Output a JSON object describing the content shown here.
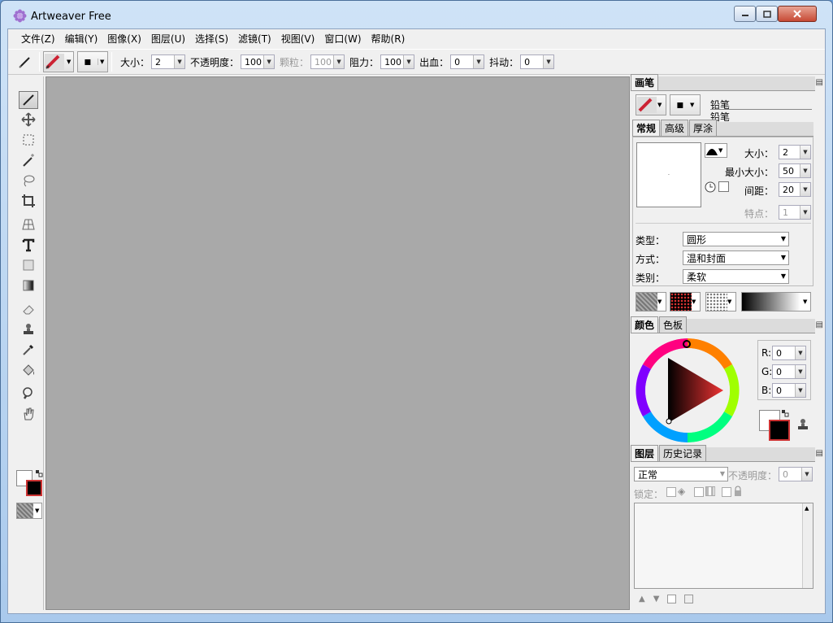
{
  "window": {
    "title": "Artweaver Free"
  },
  "menu": [
    "文件(Z)",
    "编辑(Y)",
    "图像(X)",
    "图层(U)",
    "选择(S)",
    "滤镜(T)",
    "视图(V)",
    "窗口(W)",
    "帮助(R)"
  ],
  "toolbar": {
    "size_label": "大小：",
    "size_value": "2",
    "opacity_label": "不透明度：",
    "opacity_value": "100",
    "grain_label": "颗粒：",
    "grain_value": "100",
    "resistance_label": "阻力：",
    "resistance_value": "100",
    "bleed_label": "出血：",
    "bleed_value": "0",
    "jitter_label": "抖动：",
    "jitter_value": "0"
  },
  "brush_panel": {
    "tab": "画笔",
    "category": "铅笔",
    "variant": "铅笔",
    "subtabs": [
      "常规",
      "高级",
      "厚涂"
    ],
    "size_label": "大小：",
    "size_value": "2",
    "min_size_label": "最小大小：",
    "min_size_value": "50",
    "spacing_label": "间距：",
    "spacing_value": "20",
    "feature_label": "特点：",
    "feature_value": "1",
    "type_label": "类型：",
    "type_value": "圆形",
    "method_label": "方式：",
    "method_value": "温和封面",
    "kind_label": "类别：",
    "kind_value": "柔软"
  },
  "color_panel": {
    "tabs": [
      "颜色",
      "色板"
    ],
    "r_label": "R:",
    "r_value": "0",
    "g_label": "G:",
    "g_value": "0",
    "b_label": "B:",
    "b_value": "0"
  },
  "layers_panel": {
    "tabs": [
      "图层",
      "历史记录"
    ],
    "blend_mode": "正常",
    "opacity_label": "不透明度：",
    "opacity_value": "0",
    "lock_label": "锁定："
  },
  "colors": {
    "canvas": "#a9a9a9",
    "foreground": "#000000",
    "background": "#ffffff"
  }
}
